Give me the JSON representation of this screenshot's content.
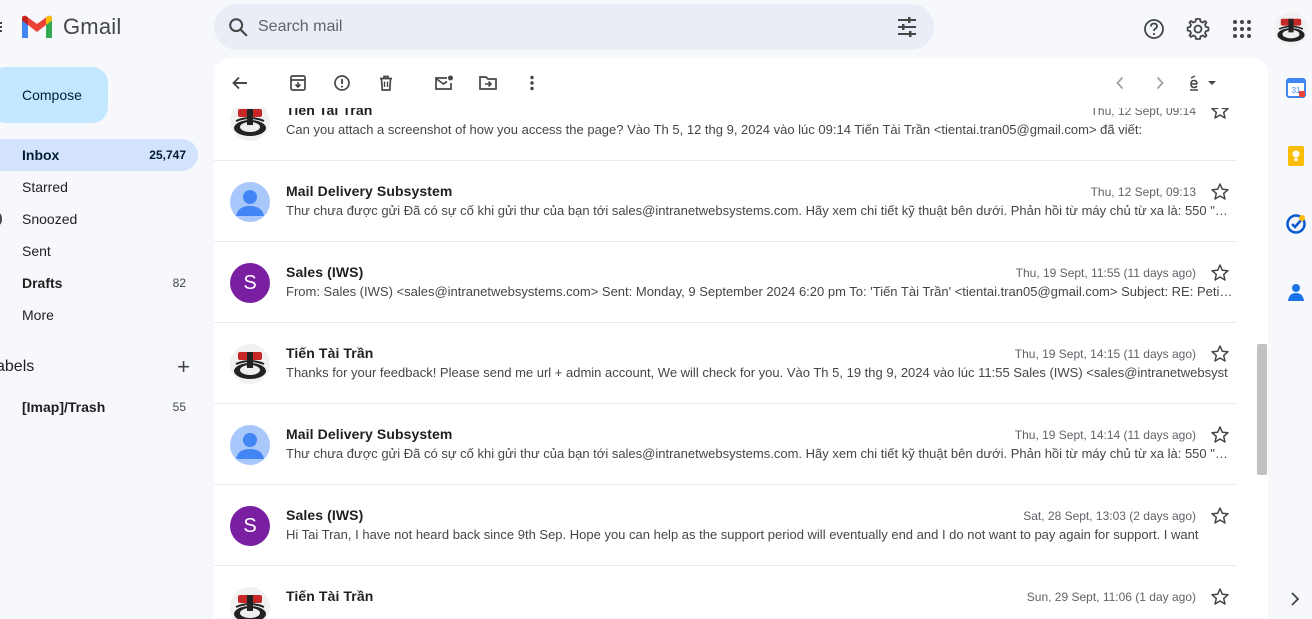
{
  "app": {
    "name": "Gmail"
  },
  "search": {
    "placeholder": "Search mail"
  },
  "sidebar": {
    "compose_label": "Compose",
    "items": [
      {
        "label": "Inbox",
        "count": "25,747",
        "active": true
      },
      {
        "label": "Starred",
        "count": ""
      },
      {
        "label": "Snoozed",
        "count": ""
      },
      {
        "label": "Sent",
        "count": ""
      },
      {
        "label": "Drafts",
        "count": "82",
        "bold": true
      },
      {
        "label": "More",
        "count": ""
      }
    ],
    "labels_heading": "abels",
    "labels": [
      {
        "label": "[Imap]/Trash",
        "count": "55"
      }
    ]
  },
  "thread": {
    "messages": [
      {
        "sender": "Tien Tai Tran",
        "date": "Thu, 12 Sept, 09:14",
        "snippet": "Can you attach a screenshot of how you access the page? Vào Th 5, 12 thg 9, 2024 vào lúc 09:14 Tiến Tài Trần <tientai.tran05@gmail.com> đã viết:",
        "avatar": "photo"
      },
      {
        "sender": "Mail Delivery Subsystem",
        "date": "Thu, 12 Sept, 09:13",
        "snippet": "Thư chưa được gửi Đã có sự cố khi gửi thư của bạn tới sales@intranetwebsystems.com. Hãy xem chi tiết kỹ thuật bên dưới. Phản hồi từ máy chủ từ xa là: 550 \"T…",
        "avatar": "person"
      },
      {
        "sender": "Sales (IWS)",
        "date": "Thu, 19 Sept, 11:55 (11 days ago)",
        "snippet": "From: Sales (IWS) <sales@intranetwebsystems.com> Sent: Monday, 9 September 2024 6:20 pm To: 'Tiến Tài Trần' <tientai.tran05@gmail.com> Subject: RE: Peti…",
        "avatar": "letter",
        "avatar_letter": "S"
      },
      {
        "sender": "Tiến Tài Trần",
        "date": "Thu, 19 Sept, 14:15 (11 days ago)",
        "snippet": "Thanks for your feedback! Please send me url + admin account, We will check for you. Vào Th 5, 19 thg 9, 2024 vào lúc 11:55 Sales (IWS) <sales@intranetwebsyst",
        "avatar": "photo"
      },
      {
        "sender": "Mail Delivery Subsystem",
        "date": "Thu, 19 Sept, 14:14 (11 days ago)",
        "snippet": "Thư chưa được gửi Đã có sự cố khi gửi thư của bạn tới sales@intranetwebsystems.com. Hãy xem chi tiết kỹ thuật bên dưới. Phản hồi từ máy chủ từ xa là: 550 \"T…",
        "avatar": "person"
      },
      {
        "sender": "Sales (IWS)",
        "date": "Sat, 28 Sept, 13:03 (2 days ago)",
        "snippet": "Hi Tai Tran, I have not heard back since 9th Sep. Hope you can help as the support period will eventually end and I do not want to pay again for support. I want",
        "avatar": "letter",
        "avatar_letter": "S"
      },
      {
        "sender": "Tiến Tài Trần",
        "date": "Sun, 29 Sept, 11:06 (1 day ago)",
        "snippet": "",
        "avatar": "photo"
      }
    ]
  },
  "colors": {
    "accent": "#0b57d0",
    "compose_bg": "#c2e7ff",
    "inbox_active_bg": "#d3e3fd",
    "letter_avatar": "#7b1fa2",
    "person_avatar_bg": "#a8c7fa",
    "person_avatar_fg": "#4285f4"
  },
  "icons": {
    "toolbar": [
      "back-arrow-icon",
      "archive-icon",
      "report-spam-icon",
      "delete-icon",
      "mark-unread-icon",
      "move-to-icon",
      "more-vert-icon"
    ],
    "toolbar_right": [
      "newer-icon",
      "older-icon",
      "input-tools-icon",
      "dropdown-icon"
    ],
    "top_right": [
      "help-icon",
      "settings-icon",
      "apps-icon"
    ],
    "side_panel": [
      "calendar-icon",
      "keep-icon",
      "tasks-icon",
      "contacts-icon"
    ]
  }
}
